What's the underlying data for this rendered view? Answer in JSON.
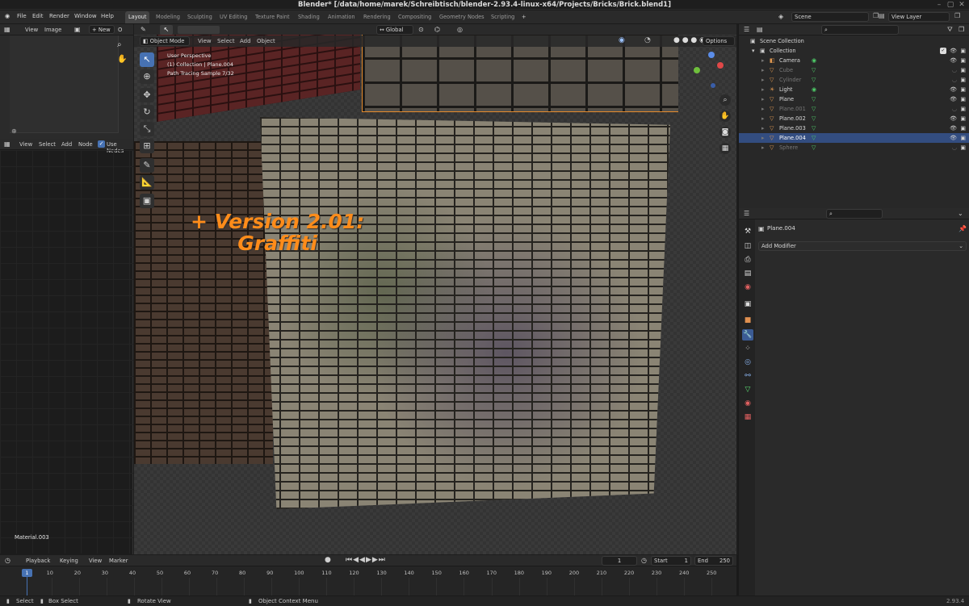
{
  "window": {
    "title": "Blender* [/data/home/marek/Schreibtisch/blender-2.93.4-linux-x64/Projects/Bricks/Brick.blend1]"
  },
  "menu": [
    "File",
    "Edit",
    "Render",
    "Window",
    "Help"
  ],
  "workspaces": {
    "active": "Layout",
    "others": [
      "Modeling",
      "Sculpting",
      "UV Editing",
      "Texture Paint",
      "Shading",
      "Animation",
      "Rendering",
      "Compositing",
      "Geometry Nodes",
      "Scripting"
    ],
    "add": "+"
  },
  "scene": {
    "label": "Scene",
    "view_layer": "View Layer"
  },
  "image_editor": {
    "menus": [
      "View",
      "Image"
    ],
    "new_label": "New"
  },
  "node_editor": {
    "menus": [
      "View",
      "Select",
      "Add",
      "Node"
    ],
    "use_nodes_label": "Use Nodes",
    "material_label": "Material.003"
  },
  "viewport": {
    "mode": "Object Mode",
    "menus": [
      "View",
      "Select",
      "Add",
      "Object"
    ],
    "orientation": "Global",
    "options_label": "Options",
    "overlay_lines": [
      "User Perspective",
      "(1) Collection | Plane.004",
      "Path Tracing Sample 7/32"
    ],
    "annotation": [
      "+ Version 2.01:",
      "Graffiti"
    ],
    "annotation_color": "#ff8c1a"
  },
  "outliner": {
    "root": "Scene Collection",
    "collection": "Collection",
    "items": [
      {
        "name": "Camera",
        "icon": "camera-icon",
        "dim": false,
        "selected": false,
        "color": "#e09850"
      },
      {
        "name": "Cube",
        "icon": "mesh-icon",
        "dim": true,
        "selected": false,
        "color": "#e09850"
      },
      {
        "name": "Cylinder",
        "icon": "mesh-icon",
        "dim": true,
        "selected": false,
        "color": "#e09850"
      },
      {
        "name": "Light",
        "icon": "light-icon",
        "dim": false,
        "selected": false,
        "color": "#e09850"
      },
      {
        "name": "Plane",
        "icon": "mesh-icon",
        "dim": false,
        "selected": false,
        "color": "#e09850"
      },
      {
        "name": "Plane.001",
        "icon": "mesh-icon",
        "dim": true,
        "selected": false,
        "color": "#e09850"
      },
      {
        "name": "Plane.002",
        "icon": "mesh-icon",
        "dim": false,
        "selected": false,
        "color": "#e09850"
      },
      {
        "name": "Plane.003",
        "icon": "mesh-icon",
        "dim": false,
        "selected": false,
        "color": "#e09850"
      },
      {
        "name": "Plane.004",
        "icon": "mesh-icon",
        "dim": false,
        "selected": true,
        "color": "#e09850"
      },
      {
        "name": "Sphere",
        "icon": "mesh-icon",
        "dim": true,
        "selected": false,
        "color": "#e09850"
      }
    ]
  },
  "properties": {
    "object_name": "Plane.004",
    "add_modifier_label": "Add Modifier"
  },
  "timeline": {
    "menus": [
      "Playback",
      "Keying",
      "View",
      "Marker"
    ],
    "current_frame": "1",
    "start_label": "Start",
    "start": "1",
    "end_label": "End",
    "end": "250",
    "ticks": [
      "1",
      "10",
      "20",
      "30",
      "40",
      "50",
      "60",
      "70",
      "80",
      "90",
      "100",
      "110",
      "120",
      "130",
      "140",
      "150",
      "160",
      "170",
      "180",
      "190",
      "200",
      "210",
      "220",
      "230",
      "240",
      "250"
    ]
  },
  "status": {
    "items": [
      "Select",
      "Box Select",
      "Rotate View",
      "Object Context Menu"
    ],
    "version": "2.93.4"
  },
  "colors": {
    "accent": "#4772b3",
    "selection": "#334d80"
  }
}
